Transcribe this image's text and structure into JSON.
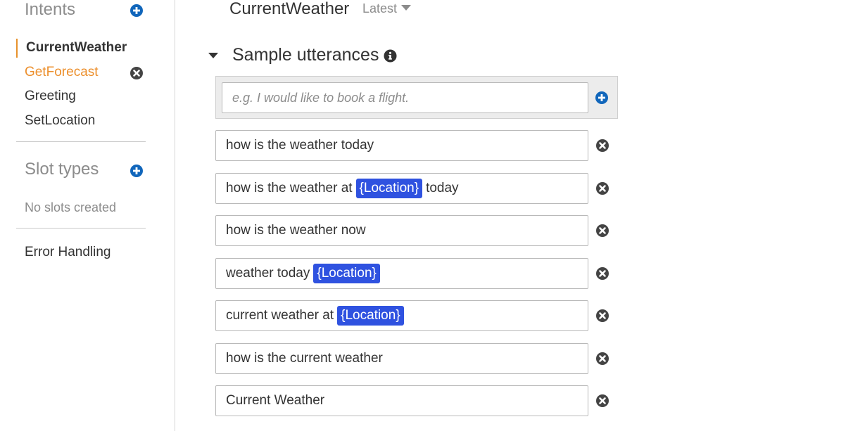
{
  "sidebar": {
    "intents_heading": "Intents",
    "intents": [
      {
        "label": "CurrentWeather",
        "state": "active"
      },
      {
        "label": "GetForecast",
        "state": "hover"
      },
      {
        "label": "Greeting",
        "state": "normal"
      },
      {
        "label": "SetLocation",
        "state": "normal"
      }
    ],
    "slot_types_heading": "Slot types",
    "no_slots_text": "No slots created",
    "error_handling_label": "Error Handling"
  },
  "header": {
    "intent_name": "CurrentWeather",
    "version_label": "Latest"
  },
  "sample_utterances": {
    "title": "Sample utterances",
    "placeholder": "e.g. I would like to book a flight.",
    "rows": [
      {
        "before": "how is the weather today",
        "slot": "",
        "after": ""
      },
      {
        "before": "how is the weather at",
        "slot": "{Location}",
        "after": "today"
      },
      {
        "before": "how is the weather now",
        "slot": "",
        "after": ""
      },
      {
        "before": "weather today",
        "slot": "{Location}",
        "after": ""
      },
      {
        "before": "current weather at",
        "slot": "{Location}",
        "after": ""
      },
      {
        "before": "how is the current weather",
        "slot": "",
        "after": ""
      },
      {
        "before": "Current Weather",
        "slot": "",
        "after": ""
      }
    ]
  },
  "colors": {
    "accent_orange": "#e7912b",
    "add_icon_blue": "#1166bb",
    "slot_blue": "#2f52e0",
    "remove_icon_dark": "#444444"
  },
  "icons": {
    "add": "plus-circle-icon",
    "remove": "x-circle-icon",
    "info": "info-circle-icon",
    "collapse": "caret-down-icon",
    "version": "caret-down-icon"
  }
}
